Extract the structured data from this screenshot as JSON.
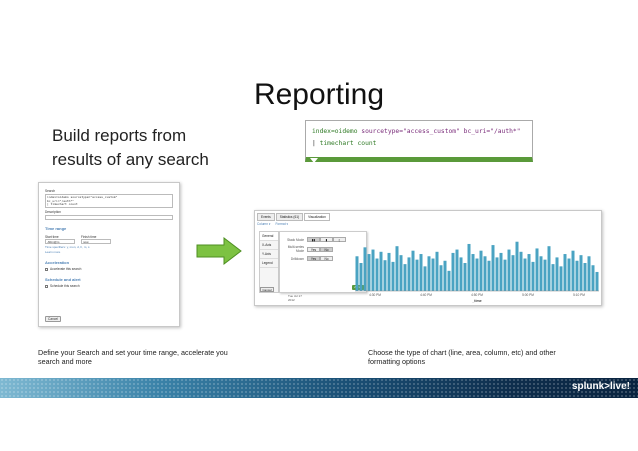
{
  "slide": {
    "title": "Reporting",
    "subtitle_line1": "Build reports from",
    "subtitle_line2": "results of any search"
  },
  "search_box": {
    "line1_index": "index=oidemo",
    "line1_rest": " sourcetype=\"access_custom\" bc_uri=\"/auth*\"",
    "line2_pipe": "| ",
    "line2_cmd": "timechart count"
  },
  "form_screenshot": {
    "search_label": "Search",
    "search_query_line1": "index=oidemo sourcetype=\"access_custom\"",
    "search_query_line2": "bc_uri=\"/auth*\"",
    "search_query_line3": "| timechart count",
    "description_label": "Description",
    "time_range_heading": "Time range",
    "start_time_label": "Start time",
    "start_time_value": "-60m@m",
    "finish_time_label": "Finish time",
    "finish_time_value": "now",
    "time_hint": "Time specifiers: y, mon, d, h, m, s",
    "learn_more": "Learn more",
    "acceleration_heading": "Acceleration",
    "accelerate_label": "Accelerate this search",
    "schedule_heading": "Schedule and alert",
    "schedule_label": "Schedule this search",
    "cancel_label": "Cancel"
  },
  "viz_screenshot": {
    "tabs": [
      "Events",
      "Statistics (61)",
      "Visualization"
    ],
    "toolbar_column": "Column",
    "toolbar_format": "Format",
    "sidebar_items": [
      "General",
      "X-Axis",
      "Y-Axis",
      "Legend"
    ],
    "stack_label": "Stack Mode",
    "multi_label": "Multi-series Mode",
    "drilldown_label": "Drilldown",
    "yes": "Yes",
    "no": "No",
    "apply_label": "Apply",
    "cancel_label": "Cancel",
    "x_axis_title": "_time",
    "x_ticks": [
      "4:30 PM",
      "4:40 PM",
      "4:50 PM",
      "5:00 PM",
      "5:10 PM"
    ],
    "stamp_line1": "Tue Jul 17",
    "stamp_line2": "2012",
    "bar_color": "#4aa3c2"
  },
  "captions": {
    "left": "Define your Search and set your time range, accelerate you search and more",
    "right": "Choose the type of chart (line, area, column, etc) and other formatting options"
  },
  "footer": {
    "brand": "splunk>live!"
  },
  "chart_data": {
    "type": "bar",
    "values": [
      62,
      50,
      78,
      66,
      74,
      58,
      70,
      55,
      68,
      52,
      80,
      64,
      48,
      60,
      72,
      56,
      66,
      44,
      62,
      58,
      70,
      46,
      54,
      36,
      68,
      74,
      60,
      50,
      84,
      66,
      58,
      72,
      62,
      54,
      82,
      60,
      68,
      56,
      74,
      64,
      88,
      70,
      58,
      66,
      52,
      76,
      62,
      56,
      80,
      48,
      60,
      44,
      66,
      58,
      72,
      54,
      64,
      50,
      62,
      46,
      34
    ],
    "x_ticks": [
      "4:30 PM",
      "4:40 PM",
      "4:50 PM",
      "5:00 PM",
      "5:10 PM"
    ],
    "xlabel": "_time",
    "ylabel": ""
  }
}
